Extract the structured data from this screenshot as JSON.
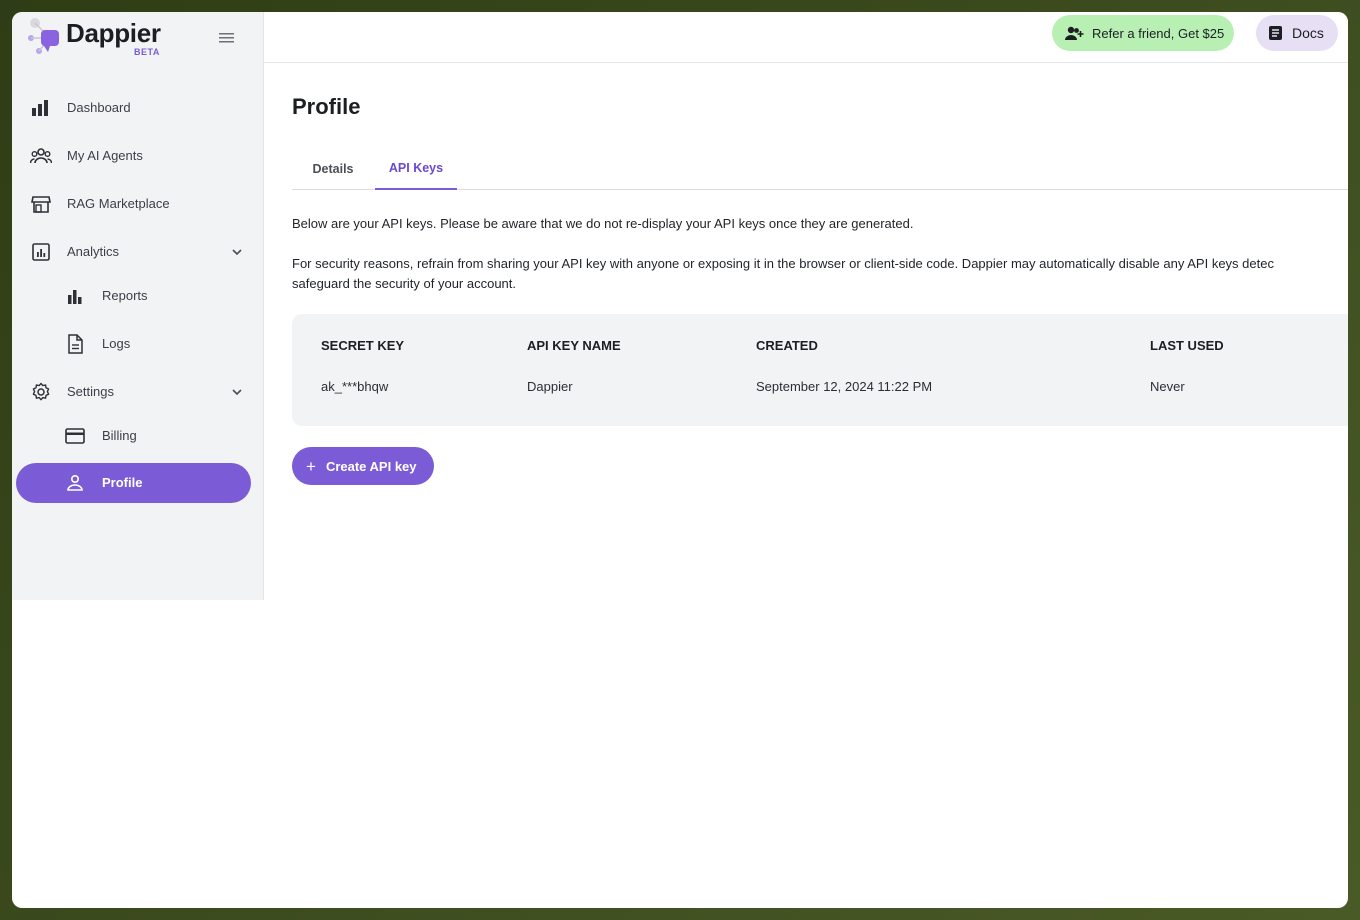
{
  "app": {
    "name": "Dappier",
    "badge": "BETA"
  },
  "sidebar": {
    "items": [
      {
        "label": "Dashboard",
        "icon": "bar-chart-icon"
      },
      {
        "label": "My AI Agents",
        "icon": "agents-group-icon"
      },
      {
        "label": "RAG Marketplace",
        "icon": "storefront-icon"
      },
      {
        "label": "Analytics",
        "icon": "analytics-icon"
      },
      {
        "label": "Reports",
        "icon": "reports-chart-icon"
      },
      {
        "label": "Logs",
        "icon": "document-icon"
      },
      {
        "label": "Settings",
        "icon": "gear-icon"
      },
      {
        "label": "Billing",
        "icon": "credit-card-icon"
      },
      {
        "label": "Profile",
        "icon": "person-icon"
      }
    ],
    "active": "Profile"
  },
  "topbar": {
    "refer_label": "Refer a friend, Get $25",
    "docs_label": "Docs"
  },
  "page": {
    "title": "Profile",
    "tabs": [
      {
        "label": "Details",
        "active": false
      },
      {
        "label": "API Keys",
        "active": true
      }
    ],
    "notice_1": "Below are your API keys. Please be aware that we do not re-display your API keys once they are generated.",
    "notice_2_line_1": "For security reasons, refrain from sharing your API key with anyone or exposing it in the browser or client-side code. Dappier may automatically disable any API keys detec",
    "notice_2_line_2": "safeguard the security of your account."
  },
  "api_keys_table": {
    "columns": [
      "SECRET KEY",
      "API KEY NAME",
      "CREATED",
      "LAST USED"
    ],
    "rows": [
      [
        "ak_***bhqw",
        "Dappier",
        "September 12, 2024 11:22 PM",
        "Never"
      ]
    ]
  },
  "create_button_label": "Create API key",
  "colors": {
    "accent": "#7c5cd6",
    "refer_bg": "#b8f0b4",
    "docs_bg": "#e7e0f5",
    "sidebar_bg": "#f2f3f5"
  }
}
